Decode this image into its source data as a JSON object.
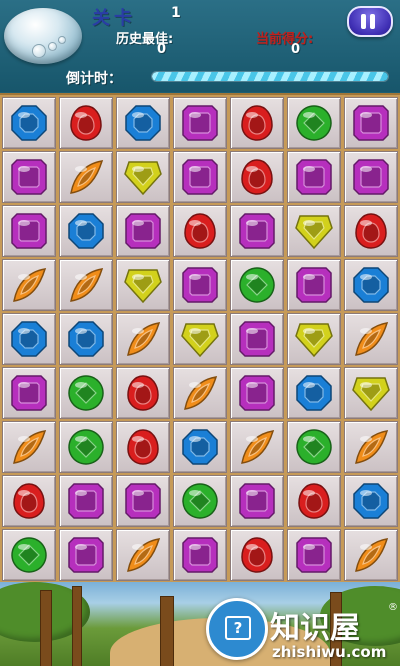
{
  "hud": {
    "level_label": "关卡",
    "level_value": "1",
    "best_label": "历史最佳:",
    "best_value": "0",
    "current_label": "当前得分:",
    "current_value": "0",
    "timer_label": "倒计时：",
    "timer_progress": 1.0
  },
  "board": {
    "rows": 9,
    "cols": 7,
    "grid": [
      [
        "blue",
        "red",
        "blue",
        "purple",
        "red",
        "green",
        "purple"
      ],
      [
        "purple",
        "orange",
        "yellow",
        "purple",
        "red",
        "purple",
        "purple"
      ],
      [
        "purple",
        "blue",
        "purple",
        "red",
        "purple",
        "yellow",
        "red"
      ],
      [
        "orange",
        "orange",
        "yellow",
        "purple",
        "green",
        "purple",
        "blue"
      ],
      [
        "blue",
        "blue",
        "orange",
        "yellow",
        "purple",
        "yellow",
        "orange"
      ],
      [
        "purple",
        "green",
        "red",
        "orange",
        "purple",
        "blue",
        "yellow"
      ],
      [
        "orange",
        "green",
        "red",
        "blue",
        "orange",
        "green",
        "orange"
      ],
      [
        "red",
        "purple",
        "purple",
        "green",
        "purple",
        "red",
        "blue"
      ],
      [
        "green",
        "purple",
        "orange",
        "purple",
        "red",
        "purple",
        "orange"
      ]
    ]
  },
  "gem_icons": {
    "blue": {
      "icon": "blue-octagon-gem-icon",
      "color": "#1a7fd6"
    },
    "red": {
      "icon": "red-drop-gem-icon",
      "color": "#d91e1e"
    },
    "purple": {
      "icon": "purple-square-gem-icon",
      "color": "#b62fbd"
    },
    "green": {
      "icon": "green-round-gem-icon",
      "color": "#2bb02b"
    },
    "orange": {
      "icon": "orange-leaf-gem-icon",
      "color": "#f08d1a"
    },
    "yellow": {
      "icon": "yellow-pentagon-gem-icon",
      "color": "#d2d11c"
    }
  },
  "watermark": {
    "brand": "知识屋",
    "registered": "®",
    "url": "zhishiwu.com"
  }
}
